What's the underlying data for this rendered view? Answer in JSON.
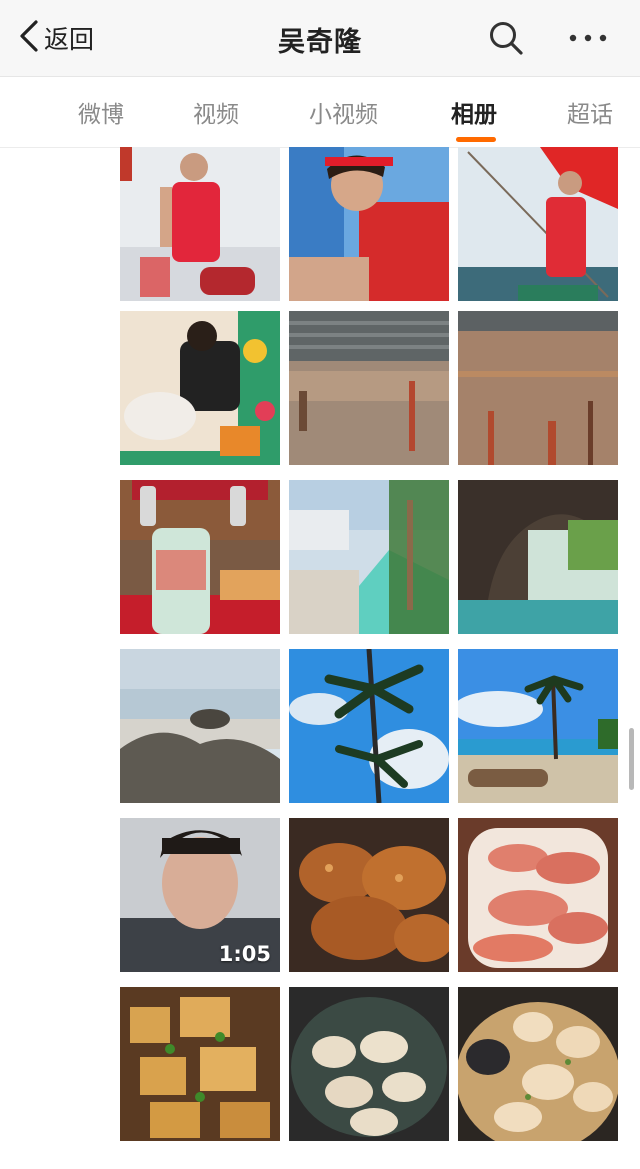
{
  "navbar": {
    "back_label": "返回",
    "title": "吴奇隆",
    "icons": [
      "back-chevron-icon",
      "search-icon",
      "more-icon"
    ]
  },
  "tabs": [
    {
      "label": "微博",
      "active": false
    },
    {
      "label": "视频",
      "active": false
    },
    {
      "label": "小视频",
      "active": false
    },
    {
      "label": "相册",
      "active": true
    },
    {
      "label": "超话",
      "active": false
    }
  ],
  "accent_color": "#ff6a00",
  "grid": {
    "video_duration": "1:05"
  }
}
